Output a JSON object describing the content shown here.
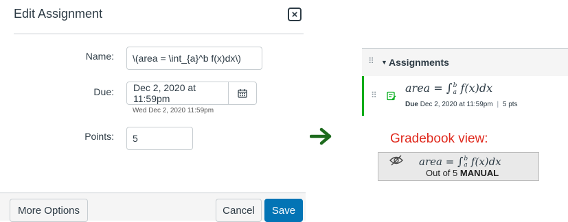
{
  "dialog": {
    "title": "Edit Assignment",
    "close_label": "×",
    "name_label": "Name:",
    "name_value": "\\(area = \\int_{a}^b f(x)dx\\)",
    "due_label": "Due:",
    "due_value": "Dec 2, 2020 at 11:59pm",
    "due_sub": "Wed Dec 2, 2020 11:59pm",
    "points_label": "Points:",
    "points_value": "5",
    "more_options_label": "More Options",
    "cancel_label": "Cancel",
    "save_label": "Save"
  },
  "assignments_panel": {
    "title": "Assignments",
    "item": {
      "lhs": "area",
      "eq": " = ",
      "integral": "∫",
      "upper": "b",
      "lower": "a",
      "rhs": " f(x)dx",
      "due_label": "Due",
      "due_value": "Dec 2, 2020 at 11:59pm",
      "sep": "|",
      "points": "5 pts"
    }
  },
  "gradebook": {
    "label": "Gradebook view:",
    "lhs": "area",
    "eq": " = ",
    "integral": "∫",
    "upper": "b",
    "lower": "a",
    "rhs": " f(x)dx",
    "out_of": "Out of 5",
    "manual": "MANUAL"
  },
  "icons": {
    "close": "close-icon",
    "calendar": "calendar-icon",
    "arrow": "arrow-right-icon",
    "drag": "drag-handle-icon",
    "caret": "caret-down-icon",
    "assignment": "assignment-icon",
    "hidden": "eye-slash-icon"
  },
  "colors": {
    "primary": "#0374b5",
    "published_accent": "#00ac18",
    "arrow": "#1e6b1e",
    "gradebook_label": "#e0291d"
  }
}
